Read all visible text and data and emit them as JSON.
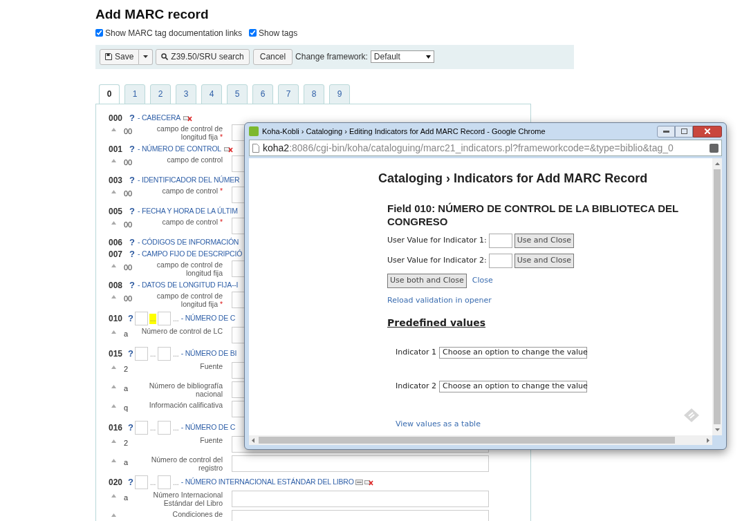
{
  "page": {
    "title": "Add MARC record",
    "options": [
      {
        "label": "Show MARC tag documentation links",
        "checked": true
      },
      {
        "label": "Show tags",
        "checked": true
      }
    ]
  },
  "toolbar": {
    "save": "Save",
    "search": "Z39.50/SRU search",
    "cancel": "Cancel",
    "framework_label": "Change framework:",
    "framework_value": "Default"
  },
  "required_symbol": "*",
  "tabs": [
    {
      "label": "0",
      "selected": true
    },
    {
      "label": "1",
      "selected": false
    },
    {
      "label": "2",
      "selected": false
    },
    {
      "label": "3",
      "selected": false
    },
    {
      "label": "4",
      "selected": false
    },
    {
      "label": "5",
      "selected": false
    },
    {
      "label": "6",
      "selected": false
    },
    {
      "label": "7",
      "selected": false
    },
    {
      "label": "8",
      "selected": false
    },
    {
      "label": "9",
      "selected": false
    }
  ],
  "fields": [
    {
      "tag": "000",
      "help": "?",
      "title": "- CABECERA",
      "clone_icon": false,
      "delete_icon": true,
      "subfields": [
        {
          "code": "00",
          "label": "campo de control de longitud fija",
          "required": true
        }
      ]
    },
    {
      "tag": "001",
      "help": "?",
      "title": "- NÚMERO DE CONTROL",
      "clone_icon": false,
      "delete_icon": true,
      "subfields": [
        {
          "code": "00",
          "label": "campo de control",
          "required": false
        }
      ]
    },
    {
      "tag": "003",
      "help": "?",
      "title": "- IDENTIFICADOR DEL NÚMER",
      "clone_icon": false,
      "delete_icon": false,
      "subfields": [
        {
          "code": "00",
          "label": "campo de control",
          "required": true
        }
      ]
    },
    {
      "tag": "005",
      "help": "?",
      "title": "- FECHA Y HORA DE LA ÚLTIM",
      "clone_icon": false,
      "delete_icon": false,
      "subfields": [
        {
          "code": "00",
          "label": "campo de control",
          "required": true
        }
      ]
    },
    {
      "tag": "006",
      "help": "?",
      "title": "- CÓDIGOS DE INFORMACIÓN",
      "clone_icon": false,
      "delete_icon": false
    },
    {
      "tag": "007",
      "help": "?",
      "title": "- CAMPO FIJO DE DESCRIPCIÓ",
      "clone_icon": false,
      "delete_icon": false,
      "subfields": [
        {
          "code": "00",
          "label": "campo de control de longitud fija",
          "required": false
        }
      ]
    },
    {
      "tag": "008",
      "help": "?",
      "title": "- DATOS DE LONGITUD FIJA--I",
      "clone_icon": false,
      "delete_icon": false,
      "subfields": [
        {
          "code": "00",
          "label": "campo de control de longitud fija",
          "required": true
        }
      ]
    },
    {
      "tag": "010",
      "help": "?",
      "indicator_links": [
        {
          "text": "...",
          "highlighted": true
        },
        {
          "text": "...",
          "highlighted": false
        }
      ],
      "title": "- NÚMERO DE C",
      "clone_icon": false,
      "delete_icon": false,
      "subfields": [
        {
          "code": "a",
          "label": "Número de control de LC",
          "required": false
        }
      ]
    },
    {
      "tag": "015",
      "help": "?",
      "indicator_links": [
        {
          "text": "...",
          "highlighted": false
        },
        {
          "text": "...",
          "highlighted": false
        }
      ],
      "title": "- NÚMERO DE BI",
      "clone_icon": false,
      "delete_icon": false,
      "subfields": [
        {
          "code": "2",
          "label": "Fuente",
          "required": false
        },
        {
          "code": "a",
          "label": "Número de bibliografía nacional",
          "required": false
        },
        {
          "code": "q",
          "label": "Información calificativa",
          "required": false
        }
      ]
    },
    {
      "tag": "016",
      "help": "?",
      "indicator_links": [
        {
          "text": "...",
          "highlighted": false
        },
        {
          "text": "...",
          "highlighted": false
        }
      ],
      "title": "- NÚMERO DE C",
      "clone_icon": false,
      "delete_icon": false,
      "subfields": [
        {
          "code": "2",
          "label": "Fuente",
          "required": false
        },
        {
          "code": "a",
          "label": "Número de control del registro",
          "required": false
        }
      ]
    },
    {
      "tag": "020",
      "help": "?",
      "indicator_links": [
        {
          "text": "...",
          "highlighted": false
        },
        {
          "text": "...",
          "highlighted": false
        }
      ],
      "title": "- NÚMERO INTERNACIONAL ESTÁNDAR DEL LIBRO",
      "clone_icon": true,
      "delete_icon": true,
      "subfields": [
        {
          "code": "a",
          "label": "Número Internacional Estándar del Libro",
          "required": false
        },
        {
          "label": "Condiciones de",
          "required": false
        }
      ]
    }
  ],
  "popup": {
    "window_title": "Koha-Kobli › Cataloging › Editing Indicators for Add MARC Record - Google Chrome",
    "url_host": "koha2",
    "url_rest": ":8086/cgi-bin/koha/cataloguing/marc21_indicators.pl?frameworkcode=&type=biblio&tag_0",
    "heading": "Cataloging › Indicators for Add MARC Record",
    "field_heading": "Field 010: NÚMERO DE CONTROL DE LA BIBLIOTECA DEL CONGRESO",
    "user_values": [
      {
        "label": "User Value for Indicator 1:",
        "button": "Use and Close"
      },
      {
        "label": "User Value for Indicator 2:",
        "button": "Use and Close"
      }
    ],
    "use_both": "Use both and Close",
    "close": "Close",
    "reload": "Reload validation in opener",
    "predefined_heading": "Predefined values",
    "indicators": [
      {
        "label": "Indicator 1",
        "placeholder": "Choose an option to change the value"
      },
      {
        "label": "Indicator 2",
        "placeholder": "Choose an option to change the value"
      }
    ],
    "table_link": "View values as a table"
  }
}
